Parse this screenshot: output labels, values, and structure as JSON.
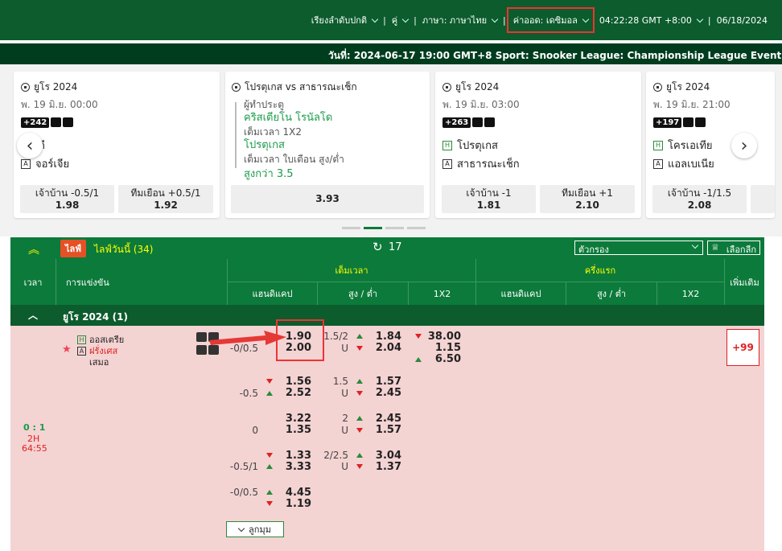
{
  "topnav": {
    "sort": "เรียงลำดับปกติ",
    "pair": "คู่",
    "language": "ภาษา: ภาษาไทย",
    "odds": "ค่าออด: เดซิมอล",
    "time": "04:22:28 GMT +8:00",
    "date": "06/18/2024"
  },
  "ticker": "วันที่: 2024-06-17 19:00 GMT+8 Sport: Snooker League: Championship League Event: Tom Ford vs",
  "cards": [
    {
      "league": "ยูโร 2024",
      "date": "พ. 19 มิ.ย. 00:00",
      "badge": "+242",
      "home": "รกี",
      "away": "จอร์เจีย",
      "o1_label": "เจ้าบ้าน -0.5/1",
      "o1_val": "1.98",
      "o2_label": "ทีมเยือน +0.5/1",
      "o2_val": "1.92"
    },
    {
      "league": "โปรตุเกส vs สาธารณะเช็ก",
      "l1": "ผู้ทำประตู",
      "v1": "คริสเตียโน โรนัลโด",
      "l2": "เต็มเวลา 1X2",
      "v2": "โปรตุเกส",
      "l3": "เต็มเวลา ใบเตือน สูง/ต่ำ",
      "v3": "สูงกว่า 3.5",
      "val": "3.93"
    },
    {
      "league": "ยูโร 2024",
      "date": "พ. 19 มิ.ย. 03:00",
      "badge": "+263",
      "home": "โปรตุเกส",
      "away": "สาธารณะเช็ก",
      "o1_label": "เจ้าบ้าน -1",
      "o1_val": "1.81",
      "o2_label": "ทีมเยือน +1",
      "o2_val": "2.10"
    },
    {
      "league": "ยูโร 2024",
      "date": "พ. 19 มิ.ย. 21:00",
      "badge": "+197",
      "home": "โครเอเทีย",
      "away": "แอลเบเนีย",
      "o1_label": "เจ้าบ้าน -1/1.5",
      "o1_val": "2.08"
    }
  ],
  "table": {
    "live_tag": "ไลฟ์",
    "live_today": "ไลฟ์วันนี้ (34)",
    "refresh_count": "17",
    "filter": "ตัวกรอง",
    "select": "เลือกลีก",
    "col_time": "เวลา",
    "col_match": "การแข่งขัน",
    "full_time": "เต็มเวลา",
    "first_half": "ครึ่งแรก",
    "more": "เพิ่มเติม",
    "handicap": "แฮนดิแคป",
    "ou": "สูง / ต่ำ",
    "x12": "1X2",
    "league": "ยูโร 2024 (1)",
    "home": "ออสเตรีย",
    "away": "ฝรั่งเศส",
    "draw": "เสมอ",
    "score": "0 : 1",
    "period": "2H",
    "clock": "64:55",
    "more_count": "+99",
    "collapse": "ลูกมุม",
    "rows": [
      {
        "hdp": "-0/0.5",
        "h1": "1.90",
        "h2": "2.00",
        "ou": "1.5/2",
        "ou_u": "U",
        "o1": "1.84",
        "o2": "2.04",
        "x1": "38.00",
        "x2": "1.15",
        "x3": "6.50"
      },
      {
        "hdp": "-0.5",
        "h1": "1.56",
        "h2": "2.52",
        "ou": "1.5",
        "ou_u": "U",
        "o1": "1.57",
        "o2": "2.45"
      },
      {
        "hdp": "0",
        "h1": "3.22",
        "h2": "1.35",
        "ou": "2",
        "ou_u": "U",
        "o1": "2.45",
        "o2": "1.57"
      },
      {
        "hdp": "-0.5/1",
        "h1": "1.33",
        "h2": "3.33",
        "ou": "2/2.5",
        "ou_u": "U",
        "o1": "3.04",
        "o2": "1.37"
      },
      {
        "hdp": "-0/0.5",
        "h1": "4.45",
        "h2": "1.19"
      }
    ]
  }
}
